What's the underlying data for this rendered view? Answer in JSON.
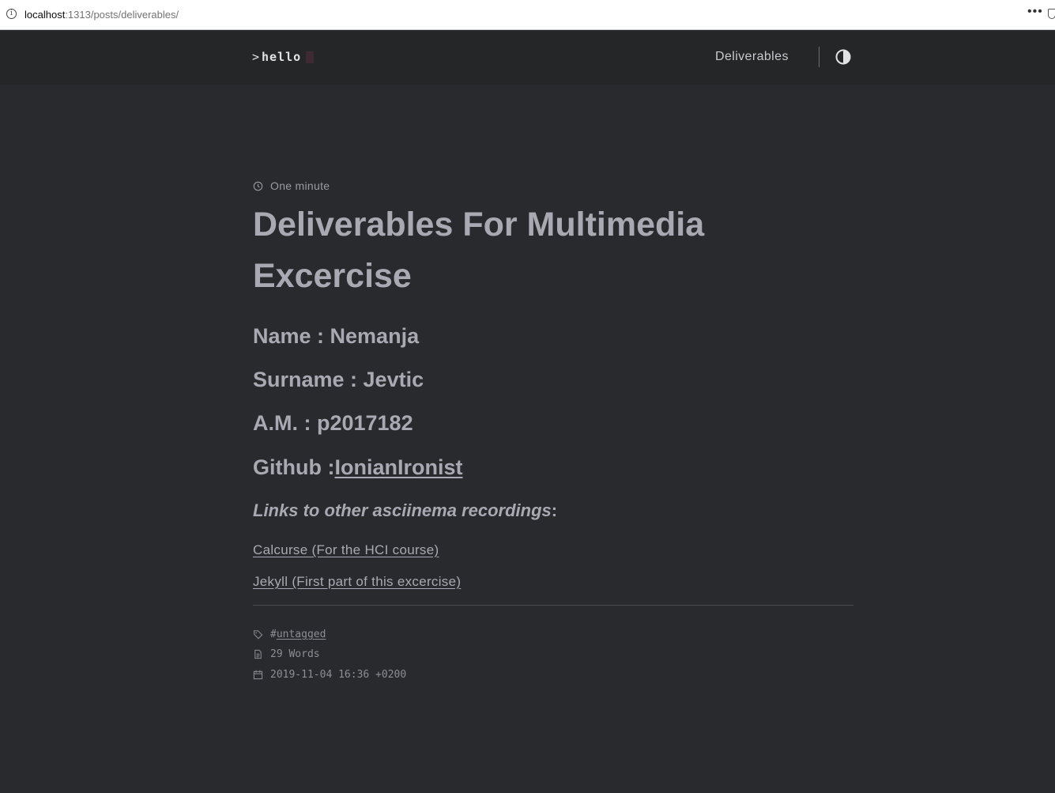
{
  "browser": {
    "url_host": "localhost",
    "url_rest": ":1313/posts/deliverables/",
    "menu_label": "•••"
  },
  "header": {
    "logo_prompt": ">",
    "logo_text": "hello",
    "nav_link": "Deliverables",
    "theme_toggle_icon": "half-circle-contrast-icon"
  },
  "post": {
    "reading_time": "One minute",
    "title": "Deliverables For Multimedia Excercise",
    "name_line": "Name : Nemanja",
    "surname_line": "Surname : Jevtic",
    "am_line": "A.M. : p2017182",
    "github_label": "Github :",
    "github_link": "IonianIronist",
    "links_heading": "Links to other asciinema recordings",
    "links_heading_suffix": ":",
    "recordings": [
      "Calcurse (For the HCI course)",
      "Jekyll (First part of this excercise)"
    ]
  },
  "footer_meta": {
    "tag_prefix": "#",
    "tag": "untagged",
    "word_count": "29 Words",
    "date": "2019-11-04 16:36 +0200"
  },
  "colors": {
    "background": "#292a2d",
    "header_background": "#252627",
    "text": "#a9a9b3"
  }
}
